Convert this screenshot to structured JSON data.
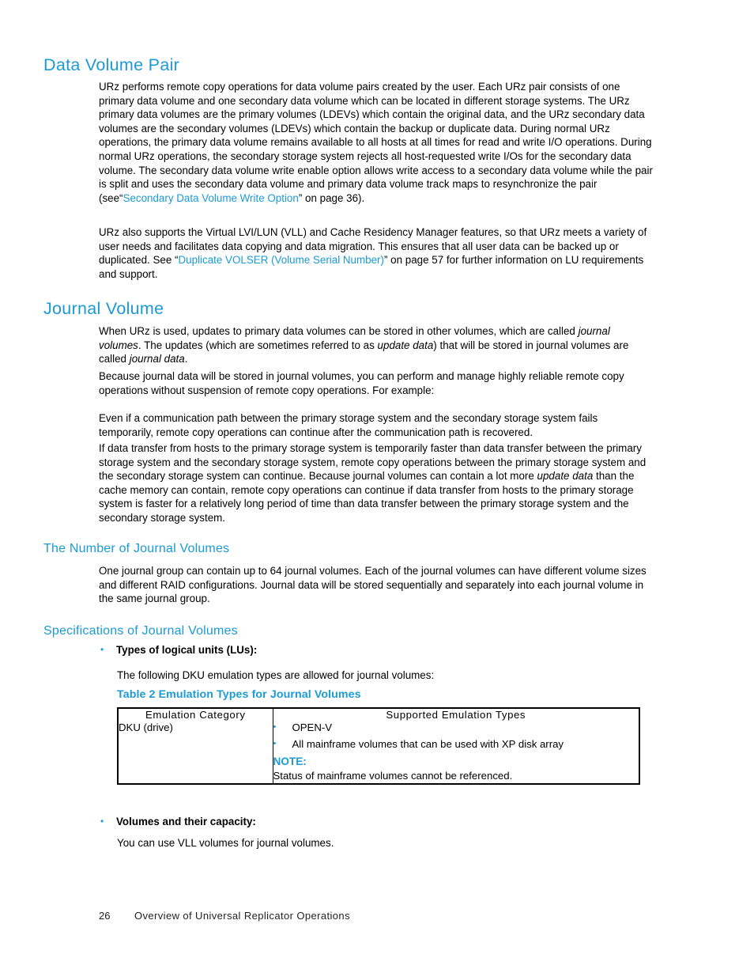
{
  "page": {
    "number": "26",
    "footer_title": "Overview of Universal Replicator Operations"
  },
  "colors": {
    "heading_blue": "#1b9ad6",
    "link_blue": "#1b9ad6",
    "body_black": "#000000",
    "table_border": "#000000"
  },
  "sections": {
    "data_volume_pair": {
      "heading": "Data Volume Pair",
      "para1_before_link": "URz performs remote copy operations for data volume pairs created by the user.  Each URz pair consists of one primary data volume and one secondary data volume which can be located in different storage systems.  The URz primary data volumes are the primary volumes (LDEVs) which contain the original data, and the URz secondary data volumes are the secondary volumes (LDEVs) which contain the backup or duplicate data.  During normal URz operations, the primary data volume remains available to all hosts at all times for read and write I/O operations.  During normal URz operations, the secondary storage system rejects all host-requested write I/Os for the secondary data volume.  The secondary data volume write enable option allows write access to a secondary data volume while the pair is split and uses the secondary data volume and primary data volume track maps to resynchronize the pair (see“",
      "para1_link": "Secondary Data Volume Write Option",
      "para1_after_link": "” on page 36).",
      "para2_before_link": "URz also supports the Virtual LVI/LUN (VLL) and Cache Residency Manager features, so that URz meets a variety of user needs and facilitates data copying and data migration.  This ensures that all user data can be backed up or duplicated.  See “",
      "para2_link": "Duplicate VOLSER (Volume Serial Number)",
      "para2_after_link": "” on page 57 for further information on LU requirements and support."
    },
    "journal_volume": {
      "heading": "Journal Volume",
      "para1_a": "When URz is used, updates to primary data volumes can be stored in other volumes, which are called ",
      "para1_em1": "journal volumes",
      "para1_b": ".  The updates (which are sometimes referred to as ",
      "para1_em2": "update data",
      "para1_c": ") that will be stored in journal volumes are called ",
      "para1_em3": "journal data",
      "para1_d": ".",
      "para2": "Because journal data will be stored in journal volumes, you can perform and manage highly reliable remote copy operations without suspension of remote copy operations.  For example:",
      "para3": "Even if a communication path between the primary storage system and the secondary storage system fails temporarily, remote copy operations can continue after the communication path is recovered.",
      "para4_a": "If data transfer from hosts to the primary storage system is temporarily faster than data transfer between the primary storage system and the secondary storage system, remote copy operations between the primary storage system and the secondary storage system can continue.  Because journal volumes can contain a lot more ",
      "para4_em": "update data",
      "para4_b": " than the cache memory can contain, remote copy operations can continue if data transfer from hosts to the primary storage system is faster for a relatively long period of time than data transfer between the primary storage system and the secondary storage system."
    },
    "number_of_journal_volumes": {
      "heading": "The Number of Journal Volumes",
      "para1": "One journal group can contain up to 64 journal volumes.  Each of the journal volumes can have different volume sizes and different RAID configurations.  Journal data will be stored sequentially and separately into each journal volume in the same journal group."
    },
    "specifications": {
      "heading": "Specifications of Journal Volumes",
      "bullet1_label": "Types of logical units (LUs):",
      "bullet1_text": "The following DKU emulation types are allowed for journal volumes:",
      "bullet2_label": "Volumes and their capacity:",
      "bullet2_text": "You can use VLL volumes for journal volumes.",
      "bullet_glyph": "•"
    }
  },
  "table": {
    "caption": "Table 2 Emulation Types for Journal Volumes",
    "headers": [
      "Emulation Category",
      "Supported Emulation Types"
    ],
    "rows": [
      {
        "category": "DKU (drive)",
        "items": [
          "OPEN-V",
          "All mainframe volumes that can be used with XP disk array"
        ],
        "note_label": "NOTE:",
        "note_text": "Status of mainframe volumes cannot be referenced."
      }
    ],
    "bullet_glyph": "•"
  }
}
